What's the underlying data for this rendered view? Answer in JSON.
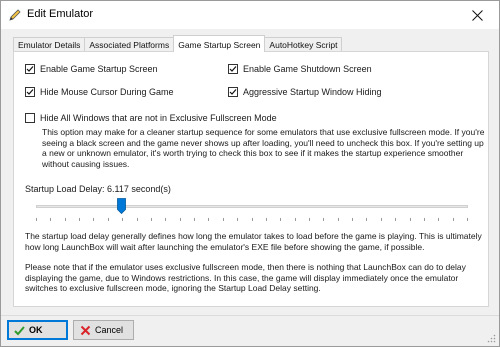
{
  "window": {
    "title": "Edit Emulator"
  },
  "tabs": [
    {
      "label": "Emulator Details"
    },
    {
      "label": "Associated Platforms"
    },
    {
      "label": "Game Startup Screen"
    },
    {
      "label": "AutoHotkey Script"
    }
  ],
  "active_tab": "Game Startup Screen",
  "options": {
    "enable_startup": {
      "label": "Enable Game Startup Screen",
      "checked": true
    },
    "enable_shutdown": {
      "label": "Enable Game Shutdown Screen",
      "checked": true
    },
    "hide_cursor": {
      "label": "Hide Mouse Cursor During Game",
      "checked": true
    },
    "aggressive_hiding": {
      "label": "Aggressive Startup Window Hiding",
      "checked": true
    },
    "hide_all_windows": {
      "label": "Hide All Windows that are not in Exclusive Fullscreen Mode",
      "checked": false
    }
  },
  "hide_all_description": "This option may make for a cleaner startup sequence for some emulators that use exclusive fullscreen mode. If you're seeing a black screen and the game never shows up after loading, you'll need to uncheck this box. If you're setting up a new or unknown emulator, it's worth trying to check this box to see if it makes the startup experience smoother without causing issues.",
  "startup_delay": {
    "label": "Startup Load Delay: 6.117 second(s)",
    "value_seconds": 6.117
  },
  "delay_description_1": "The startup load delay generally defines how long the emulator takes to load before the game is playing. This is ultimately how long LaunchBox will wait after launching the emulator's EXE file before showing the game, if possible.",
  "delay_description_2": "Please note that if the emulator uses exclusive fullscreen mode, then there is nothing that LaunchBox can do to delay displaying the game, due to Windows restrictions. In this case, the game will display immediately once the emulator switches to exclusive fullscreen mode, ignoring the Startup Load Delay setting.",
  "buttons": {
    "ok": "OK",
    "cancel": "Cancel"
  },
  "colors": {
    "accent": "#0078d7",
    "check_green": "#2e9b2e",
    "cancel_red": "#d9252a"
  }
}
